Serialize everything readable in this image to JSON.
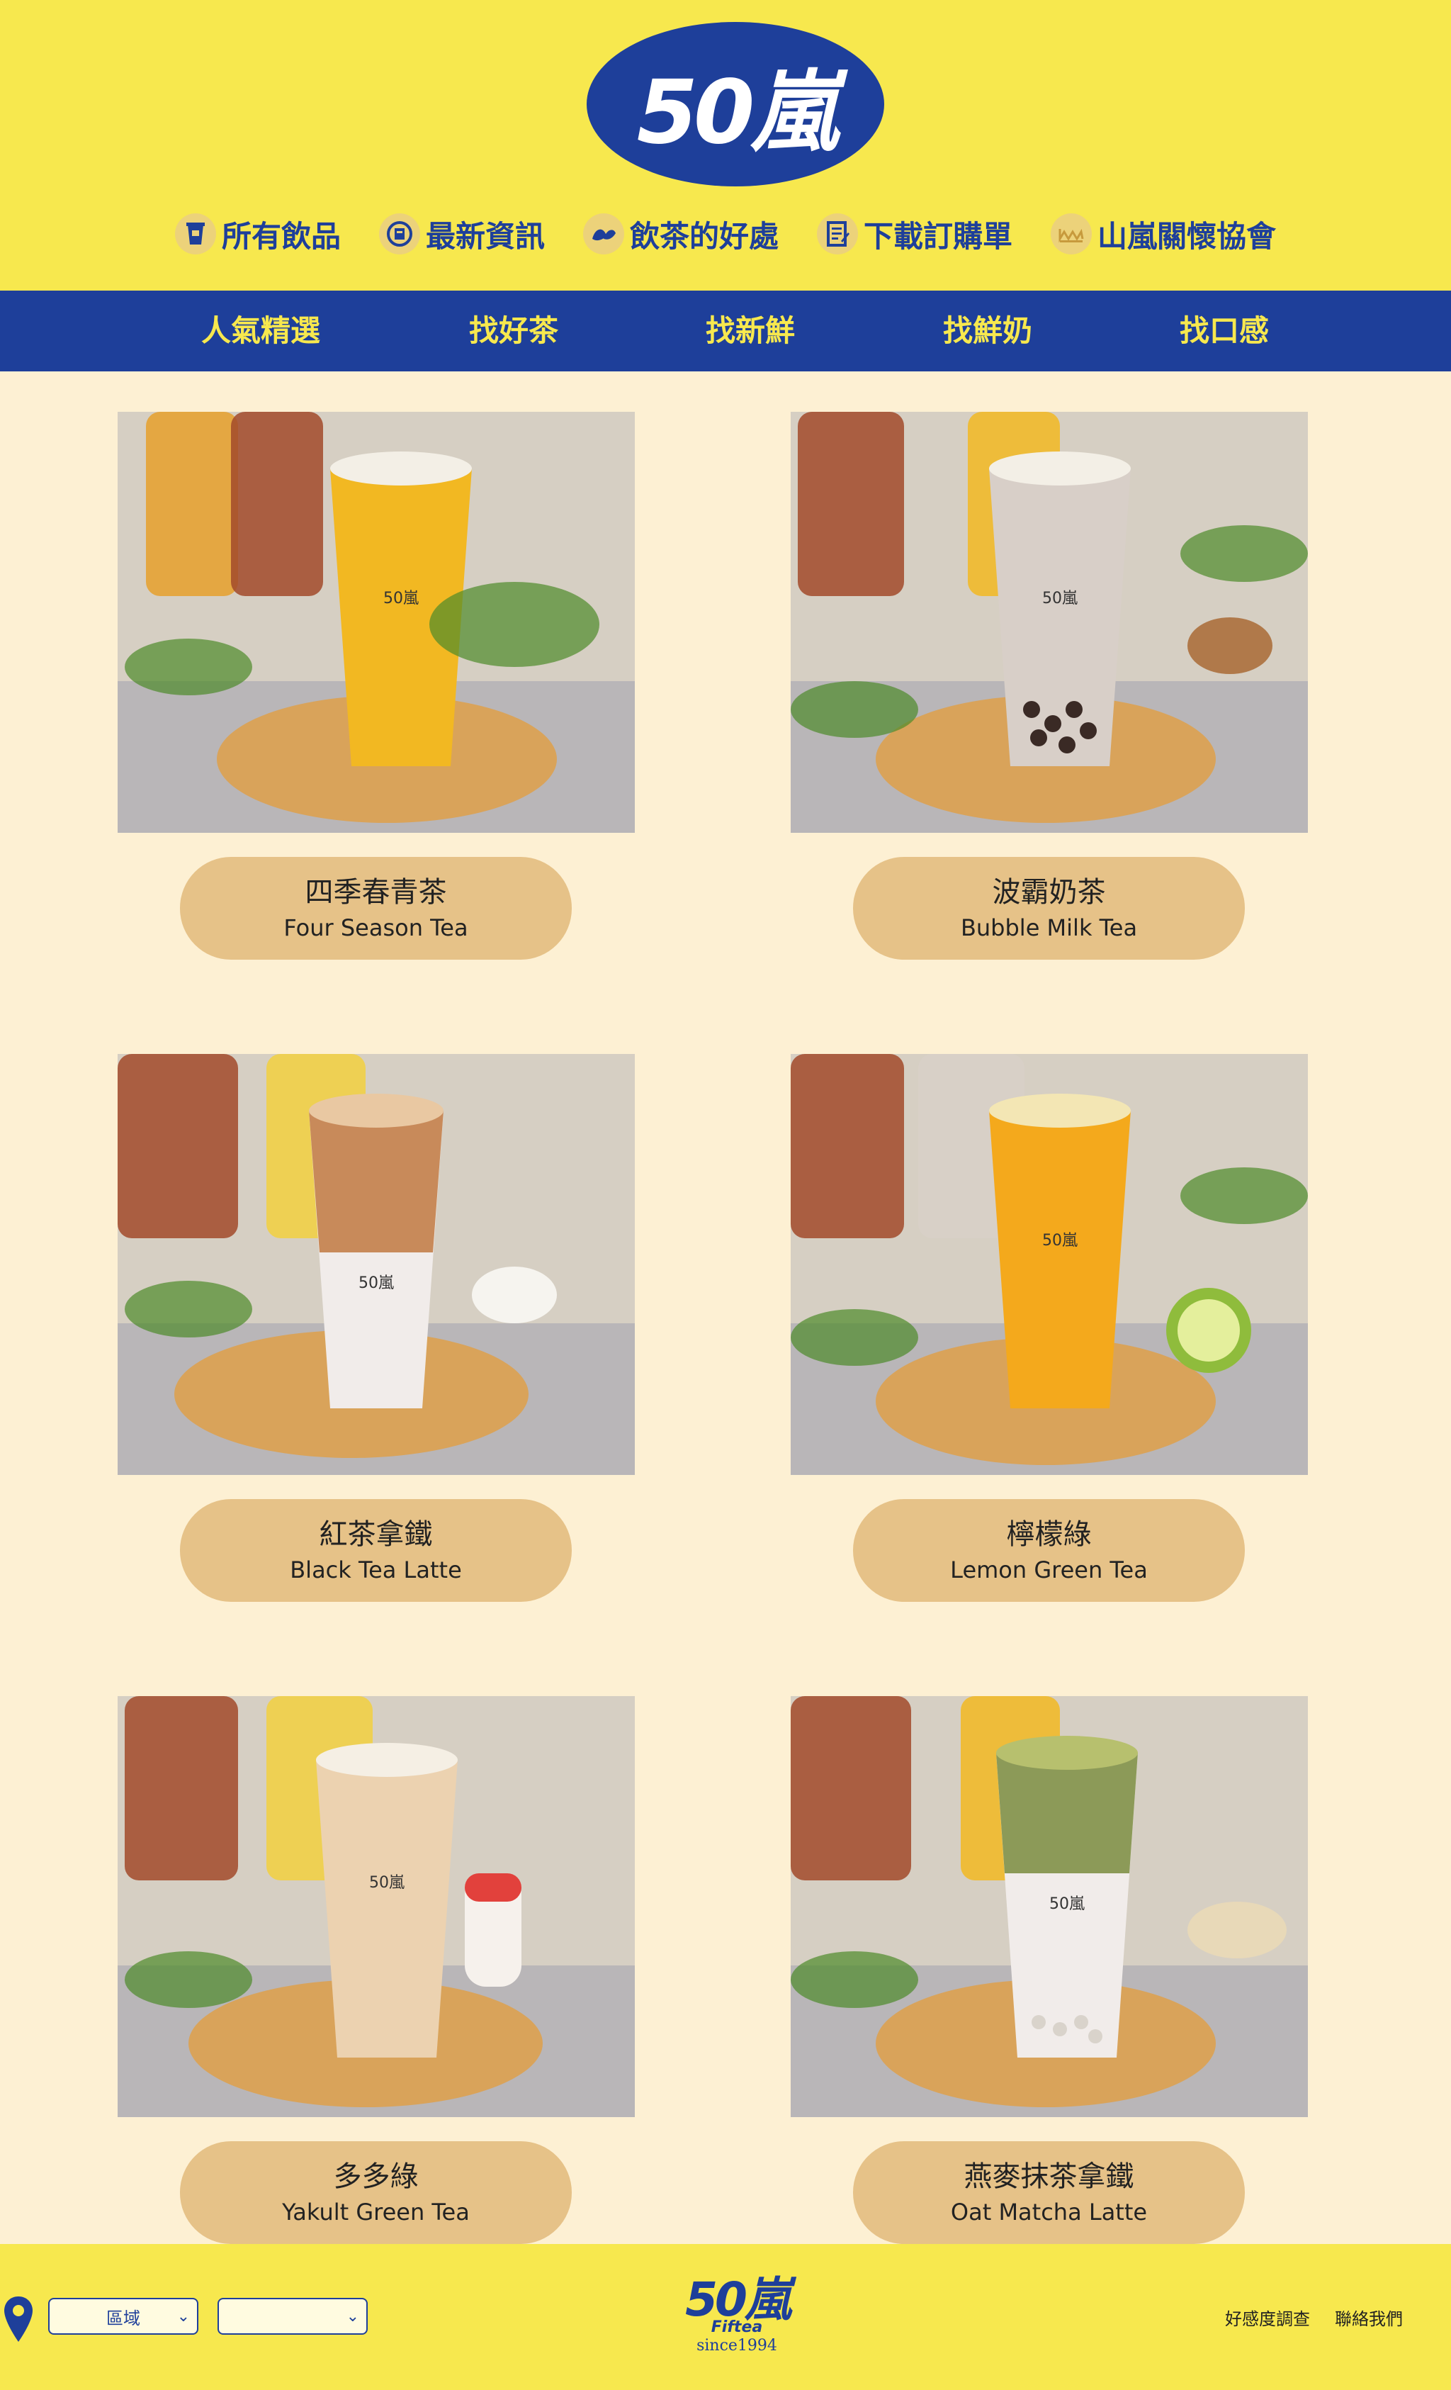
{
  "brand": {
    "logo_text": "50嵐",
    "footer_logo_main": "50嵐",
    "footer_logo_sub": "Fiftea",
    "footer_logo_since": "since1994"
  },
  "top_nav": [
    {
      "label": "所有飲品",
      "icon": "cup-icon"
    },
    {
      "label": "最新資訊",
      "icon": "news-icon"
    },
    {
      "label": "飲茶的好處",
      "icon": "leaf-icon"
    },
    {
      "label": "下載訂購單",
      "icon": "form-icon"
    },
    {
      "label": "山嵐關懷協會",
      "icon": "mountain-icon"
    }
  ],
  "categories": [
    "人氣精選",
    "找好茶",
    "找新鮮",
    "找鮮奶",
    "找口感"
  ],
  "products": [
    {
      "zh": "四季春青茶",
      "en": "Four Season Tea",
      "drink_color": "#f2b822"
    },
    {
      "zh": "波霸奶茶",
      "en": "Bubble Milk Tea",
      "drink_color": "#d8cfc8"
    },
    {
      "zh": "紅茶拿鐵",
      "en": "Black Tea Latte",
      "drink_color": "#c88a5a"
    },
    {
      "zh": "檸檬綠",
      "en": "Lemon Green Tea",
      "drink_color": "#f4a91c"
    },
    {
      "zh": "多多綠",
      "en": "Yakult Green Tea",
      "drink_color": "#ecd2b0"
    },
    {
      "zh": "燕麥抹茶拿鐵",
      "en": "Oat Matcha Latte",
      "drink_color": "#8c9a58"
    }
  ],
  "footer": {
    "region_select": "區域",
    "store_select": "",
    "links": [
      "好感度調查",
      "聯絡我們"
    ]
  },
  "colors": {
    "brand_blue": "#1e3f9a",
    "brand_yellow": "#f7e84e",
    "pill": "#e6c288",
    "background": "#fdf0d3"
  }
}
